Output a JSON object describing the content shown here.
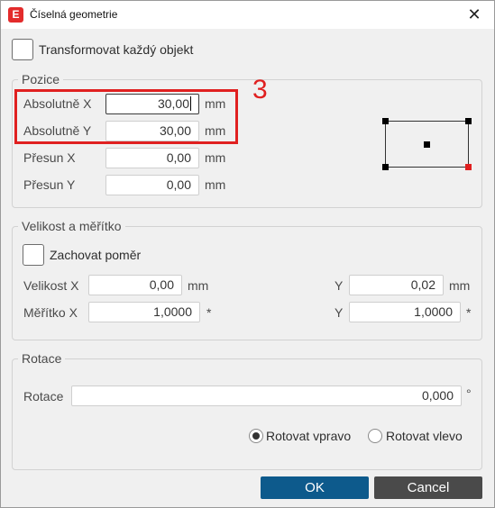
{
  "window": {
    "title": "Číselná geometrie",
    "app_icon_letter": "E",
    "close_glyph": "✕"
  },
  "transform_each": {
    "label": "Transformovat každý objekt",
    "checked": false
  },
  "position": {
    "title": "Pozice",
    "abs_x": {
      "label": "Absolutně X",
      "value": "30,00",
      "unit": "mm"
    },
    "abs_y": {
      "label": "Absolutně Y",
      "value": "30,00",
      "unit": "mm"
    },
    "move_x": {
      "label": "Přesun X",
      "value": "0,00",
      "unit": "mm"
    },
    "move_y": {
      "label": "Přesun Y",
      "value": "0,00",
      "unit": "mm"
    }
  },
  "annotation": {
    "number": "3",
    "color": "#e02020"
  },
  "size_scale": {
    "title": "Velikost a měřítko",
    "keep_ratio": {
      "label": "Zachovat poměr",
      "checked": false
    },
    "size_x": {
      "label": "Velikost X",
      "value": "0,00",
      "unit": "mm"
    },
    "size_y": {
      "label": "Y",
      "value": "0,02",
      "unit": "mm"
    },
    "scale_x": {
      "label": "Měřítko X",
      "value": "1,0000",
      "unit": "*"
    },
    "scale_y": {
      "label": "Y",
      "value": "1,0000",
      "unit": "*"
    }
  },
  "rotation": {
    "title": "Rotace",
    "label": "Rotace",
    "value": "0,000",
    "unit": "°",
    "rotate_right": {
      "label": "Rotovat vpravo",
      "selected": true
    },
    "rotate_left": {
      "label": "Rotovat vlevo",
      "selected": false
    }
  },
  "buttons": {
    "ok": "OK",
    "cancel": "Cancel"
  },
  "colors": {
    "accent": "#0d5a8c",
    "cancel": "#4a4a4a",
    "handle_active": "#e02020"
  }
}
